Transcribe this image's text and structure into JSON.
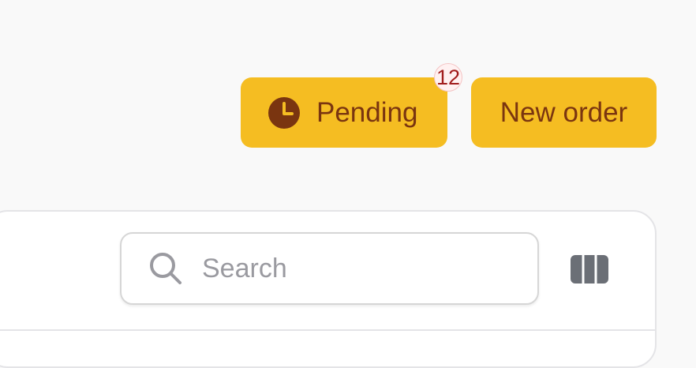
{
  "header": {
    "pending_label": "Pending",
    "pending_count": "12",
    "new_order_label": "New order"
  },
  "toolbar": {
    "search_placeholder": "Search"
  },
  "icons": {
    "pending": "clock-icon",
    "search": "search-icon",
    "columns": "columns-icon"
  },
  "colors": {
    "button_bg": "#f5bd22",
    "button_text": "#7a3510",
    "badge_text": "#a11d1d",
    "badge_bg": "#fff1f1"
  }
}
